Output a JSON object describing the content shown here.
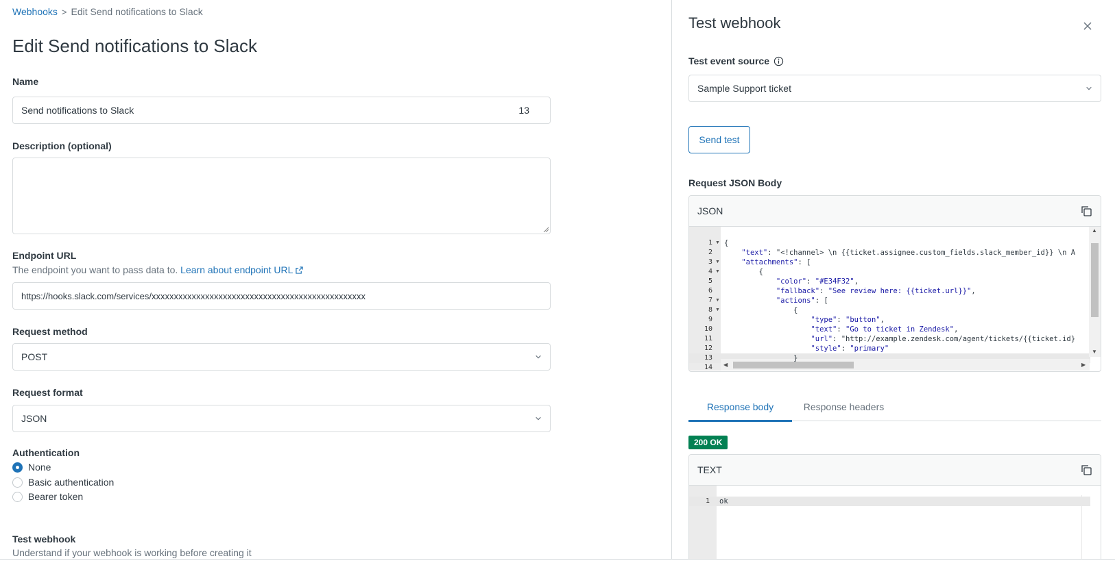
{
  "breadcrumb": {
    "parent": "Webhooks",
    "separator": ">",
    "current": "Edit Send notifications to Slack"
  },
  "page_title": "Edit Send notifications to Slack",
  "form": {
    "name": {
      "label": "Name",
      "value": "Send notifications to Slack",
      "counter": "13"
    },
    "description": {
      "label": "Description (optional)",
      "value": ""
    },
    "endpoint": {
      "label": "Endpoint URL",
      "hint": "The endpoint you want to pass data to.",
      "link": "Learn about endpoint URL",
      "value": "https://hooks.slack.com/services/xxxxxxxxxxxxxxxxxxxxxxxxxxxxxxxxxxxxxxxxxxxxxxxx"
    },
    "method": {
      "label": "Request method",
      "value": "POST"
    },
    "format": {
      "label": "Request format",
      "value": "JSON"
    },
    "auth": {
      "label": "Authentication",
      "options": [
        "None",
        "Basic authentication",
        "Bearer token"
      ],
      "selected": "None"
    },
    "test": {
      "label": "Test webhook",
      "hint": "Understand if your webhook is working before creating it"
    }
  },
  "test_panel": {
    "title": "Test webhook",
    "source_label": "Test event source",
    "source_value": "Sample Support ticket",
    "send_button": "Send test",
    "request_label": "Request JSON Body",
    "request_lang": "JSON",
    "request_lines": [
      "{",
      "    \"text\": \"<!channel> \\n {{ticket.assignee.custom_fields.slack_member_id}} \\n A",
      "    \"attachments\": [",
      "        {",
      "            \"color\": \"#E34F32\",",
      "            \"fallback\": \"See review here: {{ticket.url}}\",",
      "            \"actions\": [",
      "                {",
      "                    \"type\": \"button\",",
      "                    \"text\": \"Go to ticket in Zendesk\",",
      "                    \"url\": \"http://example.zendesk.com/agent/tickets/{{ticket.id}",
      "                    \"style\": \"primary\"",
      "                }",
      ""
    ],
    "tabs": [
      "Response body",
      "Response headers"
    ],
    "active_tab": "Response body",
    "status_badge": "200 OK",
    "response_lang": "TEXT",
    "response_lines": [
      "ok"
    ],
    "colors": {
      "accent": "#1f73b7",
      "success": "#038153",
      "border": "#d8dcde"
    }
  }
}
